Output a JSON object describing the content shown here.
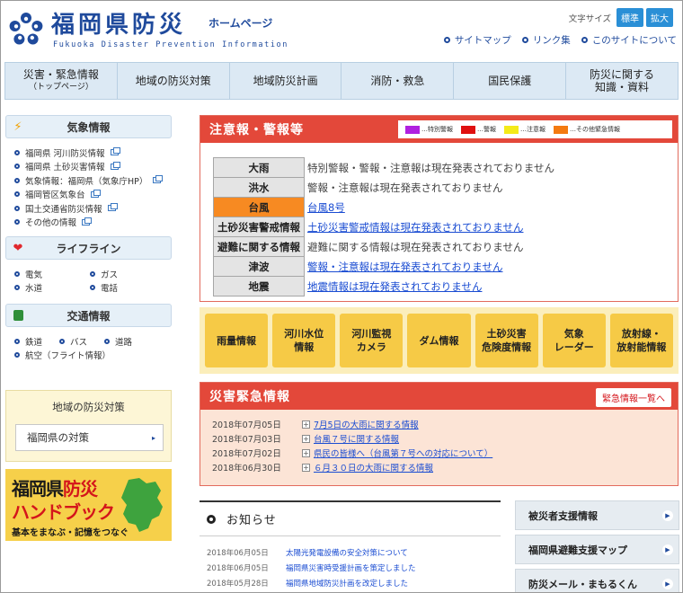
{
  "header": {
    "site_title": "福岡県防災",
    "site_sub": "ホームページ",
    "site_en": "Fukuoka Disaster Prevention Information",
    "font_size_label": "文字サイズ",
    "font_standard": "標準",
    "font_large": "拡大",
    "links": [
      "サイトマップ",
      "リンク集",
      "このサイトについて"
    ]
  },
  "nav": [
    {
      "l1": "災害・緊急情報",
      "l2": "（トップページ）"
    },
    {
      "l1": "地域の防災対策",
      "l2": ""
    },
    {
      "l1": "地域防災計画",
      "l2": ""
    },
    {
      "l1": "消防・救急",
      "l2": ""
    },
    {
      "l1": "国民保護",
      "l2": ""
    },
    {
      "l1": "防災に関する",
      "l2": "知識・資料"
    }
  ],
  "weather": {
    "title": "気象情報",
    "items": [
      "福岡県 河川防災情報",
      "福岡県 土砂災害情報",
      "気象情報：福岡県（気象庁HP）",
      "福岡管区気象台",
      "国土交通省防災情報",
      "その他の情報"
    ]
  },
  "lifeline": {
    "title": "ライフライン",
    "items": [
      "電気",
      "ガス",
      "水道",
      "電話"
    ]
  },
  "traffic": {
    "title": "交通情報",
    "items": [
      "鉄道",
      "バス",
      "道路",
      "航空（フライト情報）"
    ]
  },
  "regional": {
    "title": "地域の防災対策",
    "button": "福岡県の対策"
  },
  "banner": {
    "line1a": "福岡県",
    "line1b": "防災",
    "line2": "ハンドブック",
    "line3": "基本をまなぶ・記憶をつなぐ"
  },
  "warnings": {
    "title": "注意報・警報等",
    "legend": [
      "特別警報",
      "警報",
      "注意報",
      "その他緊急情報"
    ],
    "legend_colors": [
      "#b020e0",
      "#e01010",
      "#f4ea18",
      "#f47a10"
    ],
    "rows": [
      {
        "key": "大雨",
        "value": "特別警報・警報・注意報は現在発表されておりません"
      },
      {
        "key": "洪水",
        "value": "警報・注意報は現在発表されておりません"
      },
      {
        "key": "台風",
        "value": "台風8号"
      },
      {
        "key": "土砂災害警戒情報",
        "value": "土砂災害警戒情報は現在発表されておりません"
      },
      {
        "key": "避難に関する情報",
        "value": "避難に関する情報は現在発表されておりません"
      },
      {
        "key": "津波",
        "value": "警報・注意報は現在発表されておりません"
      },
      {
        "key": "地震",
        "value": "地震情報は現在発表されておりません"
      }
    ]
  },
  "info_buttons": [
    {
      "l1": "雨量情報",
      "l2": ""
    },
    {
      "l1": "河川水位",
      "l2": "情報"
    },
    {
      "l1": "河川監視",
      "l2": "カメラ"
    },
    {
      "l1": "ダム情報",
      "l2": ""
    },
    {
      "l1": "土砂災害",
      "l2": "危険度情報"
    },
    {
      "l1": "気象",
      "l2": "レーダー"
    },
    {
      "l1": "放射線・",
      "l2": "放射能情報"
    }
  ],
  "emergency": {
    "title": "災害緊急情報",
    "list_button": "緊急情報一覧へ",
    "items": [
      {
        "date": "2018年07月05日",
        "text": "7月5日の大雨に関する情報"
      },
      {
        "date": "2018年07月03日",
        "text": "台風７号に関する情報"
      },
      {
        "date": "2018年07月02日",
        "text": "県民の皆様へ（台風第７号への対応について）"
      },
      {
        "date": "2018年06月30日",
        "text": "６月３０日の大雨に関する情報"
      }
    ]
  },
  "news": {
    "title": "お知らせ",
    "items": [
      {
        "date": "2018年06月05日",
        "text": "太陽光発電設備の安全対策について"
      },
      {
        "date": "2018年06月05日",
        "text": "福岡県災害時受援計画を策定しました"
      },
      {
        "date": "2018年05月28日",
        "text": "福岡県地域防災計画を改定しました"
      }
    ]
  },
  "side_links": [
    "被災者支援情報",
    "福岡県避難支援マップ",
    "防災メール・まもるくん"
  ]
}
